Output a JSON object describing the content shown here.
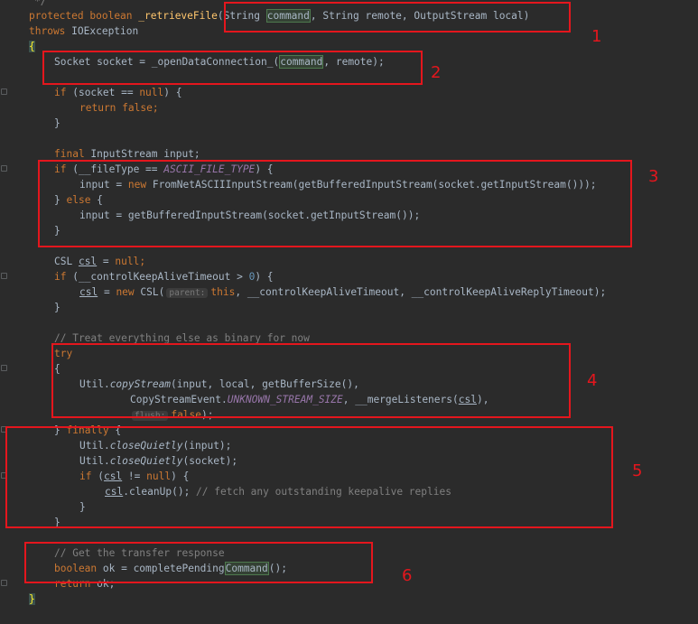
{
  "code": {
    "l00": "*/",
    "l01a": "protected",
    "l01b": "boolean",
    "l01c": "_retrieveFile",
    "l01d": "(String ",
    "l01e": "command",
    "l01f": ", String remote, OutputStream local)",
    "l02a": "throws",
    "l02b": " IOException",
    "l03": "{",
    "l04a": "Socket socket = _openDataConnection_(",
    "l04b": "command",
    "l04c": ", remote);",
    "l05a": "if",
    "l05b": " (socket == ",
    "l05c": "null",
    "l05d": ") {",
    "l06a": "return",
    "l06b": "false",
    "l06c": ";",
    "l07": "}",
    "l08a": "final",
    "l08b": " InputStream input;",
    "l09a": "if",
    "l09b": " (__fileType == ",
    "l09c": "ASCII_FILE_TYPE",
    "l09d": ") {",
    "l10a": "input = ",
    "l10b": "new",
    "l10c": " FromNetASCIIInputStream(getBufferedInputStream(socket.getInputStream()));",
    "l11a": "} ",
    "l11b": "else",
    "l11c": " {",
    "l12": "input = getBufferedInputStream(socket.getInputStream());",
    "l13": "}",
    "l14a": "CSL ",
    "l14b": "csl",
    "l14c": " = ",
    "l14d": "null",
    "l14e": ";",
    "l15a": "if",
    "l15b": " (__controlKeepAliveTimeout > ",
    "l15c": "0",
    "l15d": ") {",
    "l16a": "csl",
    "l16b": " = ",
    "l16c": "new",
    "l16d": " CSL(",
    "l16hint": "parent:",
    "l16e": "this",
    "l16f": ", __controlKeepAliveTimeout, __controlKeepAliveReplyTimeout);",
    "l17": "}",
    "l18": "// Treat everything else as binary for now",
    "l19": "try",
    "l20": "{",
    "l21a": "Util.",
    "l21b": "copyStream",
    "l21c": "(input, local, getBufferSize(),",
    "l22a": "CopyStreamEvent.",
    "l22b": "UNKNOWN_STREAM_SIZE",
    "l22c": ", __mergeListeners(",
    "l22d": "csl",
    "l22e": "),",
    "l23hint": "flush:",
    "l23a": "false",
    "l23b": ");",
    "l24a": "} ",
    "l24b": "finally",
    "l24c": " {",
    "l25a": "Util.",
    "l25b": "closeQuietly",
    "l25c": "(input);",
    "l26a": "Util.",
    "l26b": "closeQuietly",
    "l26c": "(socket);",
    "l27a": "if",
    "l27b": " (",
    "l27c": "csl",
    "l27d": " != ",
    "l27e": "null",
    "l27f": ") {",
    "l28a": "csl",
    "l28b": ".cleanUp(); ",
    "l28c": "// fetch any outstanding keepalive replies",
    "l29": "}",
    "l30": "}",
    "l31": "// Get the transfer response",
    "l32a": "boolean",
    "l32b": " ok = completePending",
    "l32c": "Command",
    "l32d": "();",
    "l33a": "return",
    "l33b": " ok;",
    "l34": "}"
  },
  "annotations": [
    "1",
    "2",
    "3",
    "4",
    "5",
    "6"
  ]
}
